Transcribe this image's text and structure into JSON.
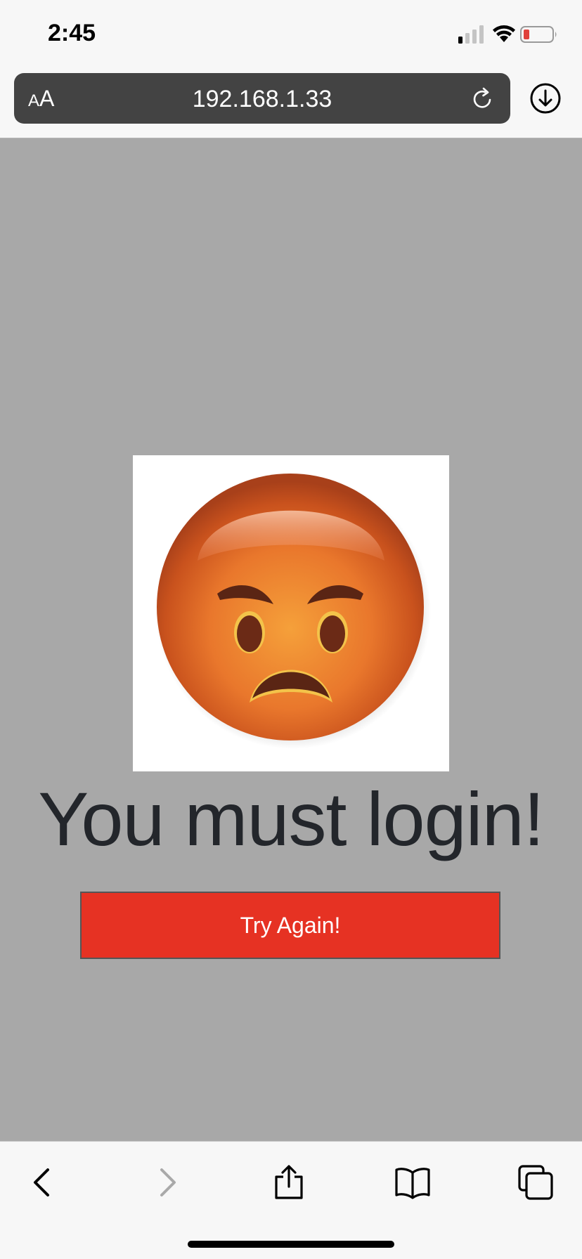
{
  "status_bar": {
    "time": "2:45",
    "icons": [
      "signal-icon",
      "wifi-icon",
      "battery-icon"
    ],
    "battery_color": "#e0413b"
  },
  "address_bar": {
    "text_size_small": "A",
    "text_size_large": "A",
    "url": "192.168.1.33",
    "icons": [
      "reload-icon",
      "download-icon"
    ]
  },
  "page": {
    "background_color": "#a8a8a8",
    "image": "angry-face-emoji",
    "headline": "You must login!",
    "button_label": "Try Again!",
    "button_color": "#e63223"
  },
  "toolbar": {
    "icons": [
      "back-icon",
      "forward-icon",
      "share-icon",
      "bookmarks-icon",
      "tabs-icon"
    ]
  }
}
